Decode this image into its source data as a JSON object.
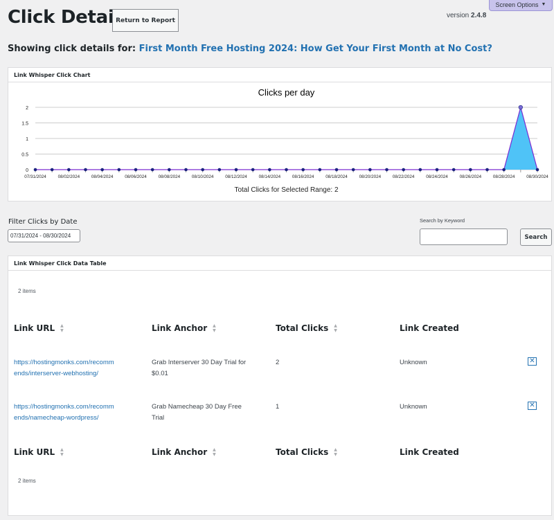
{
  "header": {
    "title": "Click Details",
    "return_label": "Return to Report",
    "screen_options_label": "Screen Options",
    "version_prefix": "version",
    "version_number": "2.4.8"
  },
  "showing": {
    "prefix": "Showing click details for:",
    "post_title": "First Month Free Hosting 2024: How Get Your First Month at No Cost?"
  },
  "chart_box": {
    "heading": "Link Whisper Click Chart",
    "total_text": "Total Clicks for Selected Range: 2"
  },
  "chart_data": {
    "type": "area",
    "title": "Clicks per day",
    "x": [
      "07/31/2024",
      "08/01/2024",
      "08/02/2024",
      "08/03/2024",
      "08/04/2024",
      "08/05/2024",
      "08/06/2024",
      "08/07/2024",
      "08/08/2024",
      "08/09/2024",
      "08/10/2024",
      "08/11/2024",
      "08/12/2024",
      "08/13/2024",
      "08/14/2024",
      "08/15/2024",
      "08/16/2024",
      "08/17/2024",
      "08/18/2024",
      "08/19/2024",
      "08/20/2024",
      "08/21/2024",
      "08/22/2024",
      "08/23/2024",
      "08/24/2024",
      "08/25/2024",
      "08/26/2024",
      "08/27/2024",
      "08/28/2024",
      "08/29/2024",
      "08/30/2024"
    ],
    "values": [
      0,
      0,
      0,
      0,
      0,
      0,
      0,
      0,
      0,
      0,
      0,
      0,
      0,
      0,
      0,
      0,
      0,
      0,
      0,
      0,
      0,
      0,
      0,
      0,
      0,
      0,
      0,
      0,
      0,
      2,
      0
    ],
    "tick_labels": [
      "07/31/2024",
      "08/02/2024",
      "08/04/2024",
      "08/06/2024",
      "08/08/2024",
      "08/10/2024",
      "08/12/2024",
      "08/14/2024",
      "08/16/2024",
      "08/18/2024",
      "08/20/2024",
      "08/22/2024",
      "08/24/2024",
      "08/26/2024",
      "08/28/2024",
      "08/30/2024"
    ],
    "y_ticks": [
      "0",
      "0.5",
      "1",
      "1.5",
      "2"
    ],
    "ylim": [
      0,
      2
    ],
    "grid": true,
    "colors": {
      "fill": "#4fc3f7",
      "line": "#7b2bd1",
      "point": "#1a237e"
    }
  },
  "filter": {
    "label": "Filter Clicks by Date",
    "date_value": "07/31/2024 - 08/30/2024",
    "search_label": "Search by Keyword",
    "search_value": "",
    "search_button": "Search"
  },
  "table": {
    "heading": "Link Whisper Click Data Table",
    "items_top": "2 items",
    "items_bottom": "2 items",
    "columns": [
      "Link URL",
      "Link Anchor",
      "Total Clicks",
      "Link Created"
    ],
    "rows": [
      {
        "url_line1": "https://hostingmonks.com/recomm",
        "url_line2": "ends/interserver-webhosting/",
        "anchor_line1": "Grab Interserver 30 Day Trial for",
        "anchor_line2": "$0.01",
        "clicks": "2",
        "created": "Unknown"
      },
      {
        "url_line1": "https://hostingmonks.com/recomm",
        "url_line2": "ends/namecheap-wordpress/",
        "anchor_line1": "Grab Namecheap 30 Day Free",
        "anchor_line2": "Trial",
        "clicks": "1",
        "created": "Unknown"
      }
    ],
    "delete_icon": "close-icon"
  }
}
